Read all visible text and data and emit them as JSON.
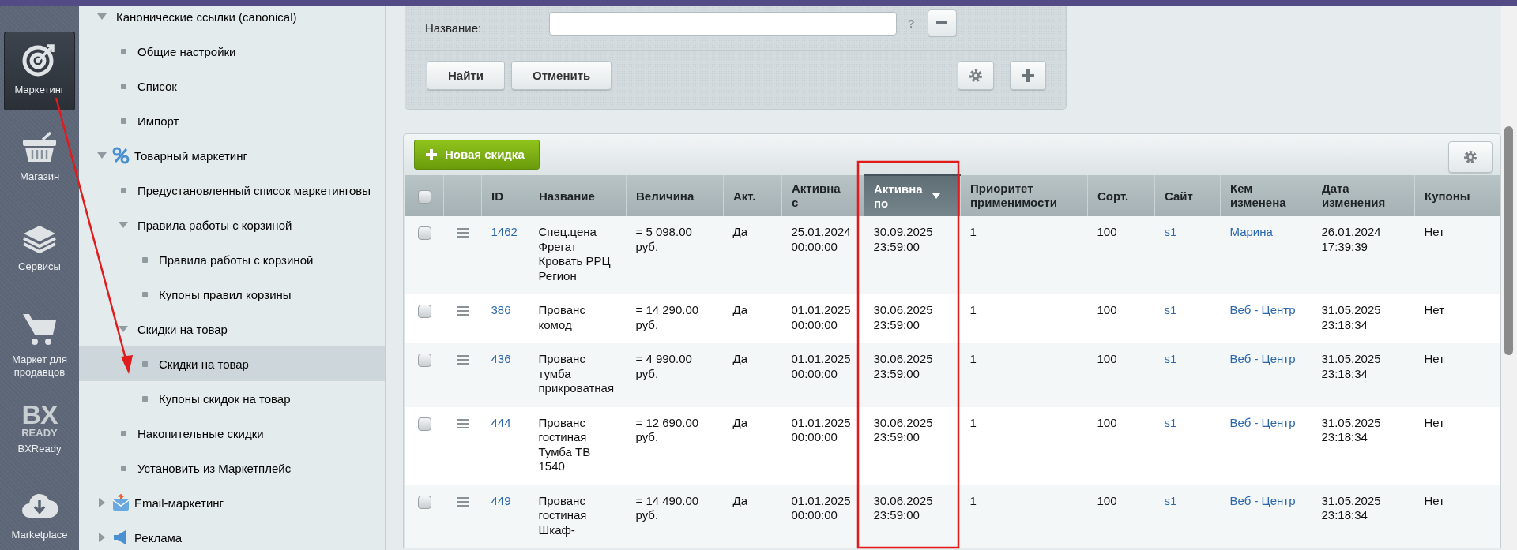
{
  "sidebar": {
    "items": [
      {
        "label": "Маркетинг",
        "kind": "target",
        "selected": true
      },
      {
        "label": "Магазин",
        "kind": "basket",
        "selected": false
      },
      {
        "label": "Сервисы",
        "kind": "layers",
        "selected": false
      },
      {
        "label": "Маркет для продавцов",
        "kind": "cart",
        "selected": false
      },
      {
        "label": "BXReady",
        "kind": "logo",
        "logo_lines": [
          "BX",
          "READY"
        ],
        "selected": false
      },
      {
        "label": "Marketplace",
        "kind": "cloud",
        "selected": false
      }
    ]
  },
  "menu": {
    "items": [
      {
        "label": "Канонические ссылки (canonical)",
        "kind": "section",
        "expanded": true,
        "selected": false,
        "children": [
          {
            "label": "Общие настройки",
            "kind": "page",
            "selected": false
          },
          {
            "label": "Список",
            "kind": "page",
            "selected": false
          },
          {
            "label": "Импорт",
            "kind": "page",
            "selected": false
          }
        ]
      },
      {
        "label": "Товарный маркетинг",
        "kind": "discounts",
        "expanded": true,
        "selected": false,
        "children": [
          {
            "label": "Предустановленный список маркетинговы",
            "kind": "page",
            "selected": false
          },
          {
            "label": "Правила работы с корзиной",
            "kind": "section",
            "expanded": true,
            "selected": false,
            "children": [
              {
                "label": "Правила работы с корзиной",
                "kind": "page",
                "selected": false
              },
              {
                "label": "Купоны правил корзины",
                "kind": "page",
                "selected": false
              }
            ]
          },
          {
            "label": "Скидки на товар",
            "kind": "section",
            "expanded": true,
            "selected": false,
            "children": [
              {
                "label": "Скидки на товар",
                "kind": "page",
                "selected": true
              },
              {
                "label": "Купоны скидок на товар",
                "kind": "page",
                "selected": false
              }
            ]
          },
          {
            "label": "Накопительные скидки",
            "kind": "page",
            "selected": false
          },
          {
            "label": "Установить из Маркетплейс",
            "kind": "page",
            "selected": false
          }
        ]
      },
      {
        "label": "Email-маркетинг",
        "kind": "email",
        "expanded": false,
        "selected": false
      },
      {
        "label": "Реклама",
        "kind": "ads",
        "expanded": false,
        "selected": false
      }
    ]
  },
  "filter": {
    "field_label": "Название:",
    "help": "?",
    "buttons": [
      "Найти",
      "Отменить"
    ]
  },
  "grid": {
    "add_button": "Новая скидка",
    "header_checked": false,
    "columns": [
      {
        "label": "ID",
        "sorted": false
      },
      {
        "label": "Название",
        "sorted": false
      },
      {
        "label": "Величина",
        "sorted": false
      },
      {
        "label": "Акт.",
        "sorted": false
      },
      {
        "label": "Активна с",
        "sorted": false
      },
      {
        "label": "Активна по",
        "sorted": true
      },
      {
        "label": "Приоритет применимости",
        "sorted": false
      },
      {
        "label": "Сорт.",
        "sorted": false
      },
      {
        "label": "Сайт",
        "sorted": false
      },
      {
        "label": "Кем изменена",
        "sorted": false
      },
      {
        "label": "Дата изменения",
        "sorted": false
      },
      {
        "label": "Купоны",
        "sorted": false
      }
    ],
    "rows": [
      {
        "checked": false,
        "id": "1462",
        "name": "Спец.цена Фрегат Кровать РРЦ Регион",
        "value": "= 5 098.00 руб.",
        "active": "Да",
        "from": "25.01.2024 00:00:00",
        "to": "30.09.2025 23:59:00",
        "priority": "1",
        "sort": "100",
        "site": "s1",
        "modified_by": "Марина",
        "modified_at": "26.01.2024 17:39:39",
        "coupons": "Нет"
      },
      {
        "checked": false,
        "id": "386",
        "name": "Прованс комод",
        "value": "= 14 290.00 руб.",
        "active": "Да",
        "from": "01.01.2025 00:00:00",
        "to": "30.06.2025 23:59:00",
        "priority": "1",
        "sort": "100",
        "site": "s1",
        "modified_by": "Веб - Центр",
        "modified_at": "31.05.2025 23:18:34",
        "coupons": "Нет"
      },
      {
        "checked": false,
        "id": "436",
        "name": "Прованс тумба прикроватная",
        "value": "= 4 990.00 руб.",
        "active": "Да",
        "from": "01.01.2025 00:00:00",
        "to": "30.06.2025 23:59:00",
        "priority": "1",
        "sort": "100",
        "site": "s1",
        "modified_by": "Веб - Центр",
        "modified_at": "31.05.2025 23:18:34",
        "coupons": "Нет"
      },
      {
        "checked": false,
        "id": "444",
        "name": "Прованс гостиная Тумба ТВ 1540",
        "value": "= 12 690.00 руб.",
        "active": "Да",
        "from": "01.01.2025 00:00:00",
        "to": "30.06.2025 23:59:00",
        "priority": "1",
        "sort": "100",
        "site": "s1",
        "modified_by": "Веб - Центр",
        "modified_at": "31.05.2025 23:18:34",
        "coupons": "Нет"
      },
      {
        "checked": false,
        "id": "449",
        "name": "Прованс гостиная Шкаф-",
        "value": "= 14 490.00 руб.",
        "active": "Да",
        "from": "01.01.2025 00:00:00",
        "to": "30.06.2025 23:59:00",
        "priority": "1",
        "sort": "100",
        "site": "s1",
        "modified_by": "Веб - Центр",
        "modified_at": "31.05.2025 23:18:34",
        "coupons": "Нет"
      }
    ]
  }
}
